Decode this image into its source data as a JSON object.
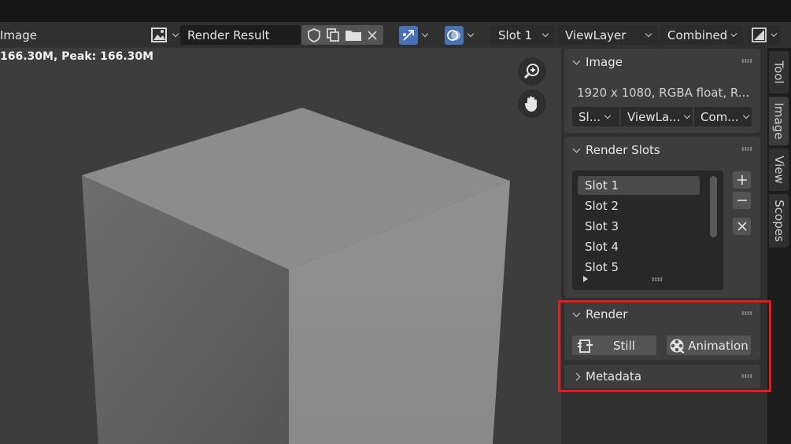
{
  "header": {
    "editor_label": "Image",
    "image_name": "Render Result",
    "slot": "Slot 1",
    "view_layer": "ViewLayer",
    "pass": "Combined"
  },
  "viewport": {
    "memory": "166.30M, Peak: 166.30M"
  },
  "sidebar": {
    "image_panel": {
      "title": "Image",
      "info": "1920 x 1080,  RGBA float,  R...",
      "dropdowns": [
        "Sl...",
        "ViewLa...",
        "Com..."
      ]
    },
    "render_slots_panel": {
      "title": "Render Slots",
      "slots": [
        "Slot 1",
        "Slot 2",
        "Slot 3",
        "Slot 4",
        "Slot 5"
      ],
      "selected_index": 0
    },
    "render_panel": {
      "title": "Render",
      "still_label": "Still",
      "animation_label": "Animation"
    },
    "metadata_panel": {
      "title": "Metadata"
    }
  },
  "tabs": [
    "Tool",
    "Image",
    "View",
    "Scopes"
  ],
  "active_tab": "Image",
  "colors": {
    "accent_blue": "#4772b3",
    "highlight_red": "#e81a1a",
    "panel_bg": "#3d3d3d",
    "viewport_bg": "#3d3d3d"
  }
}
